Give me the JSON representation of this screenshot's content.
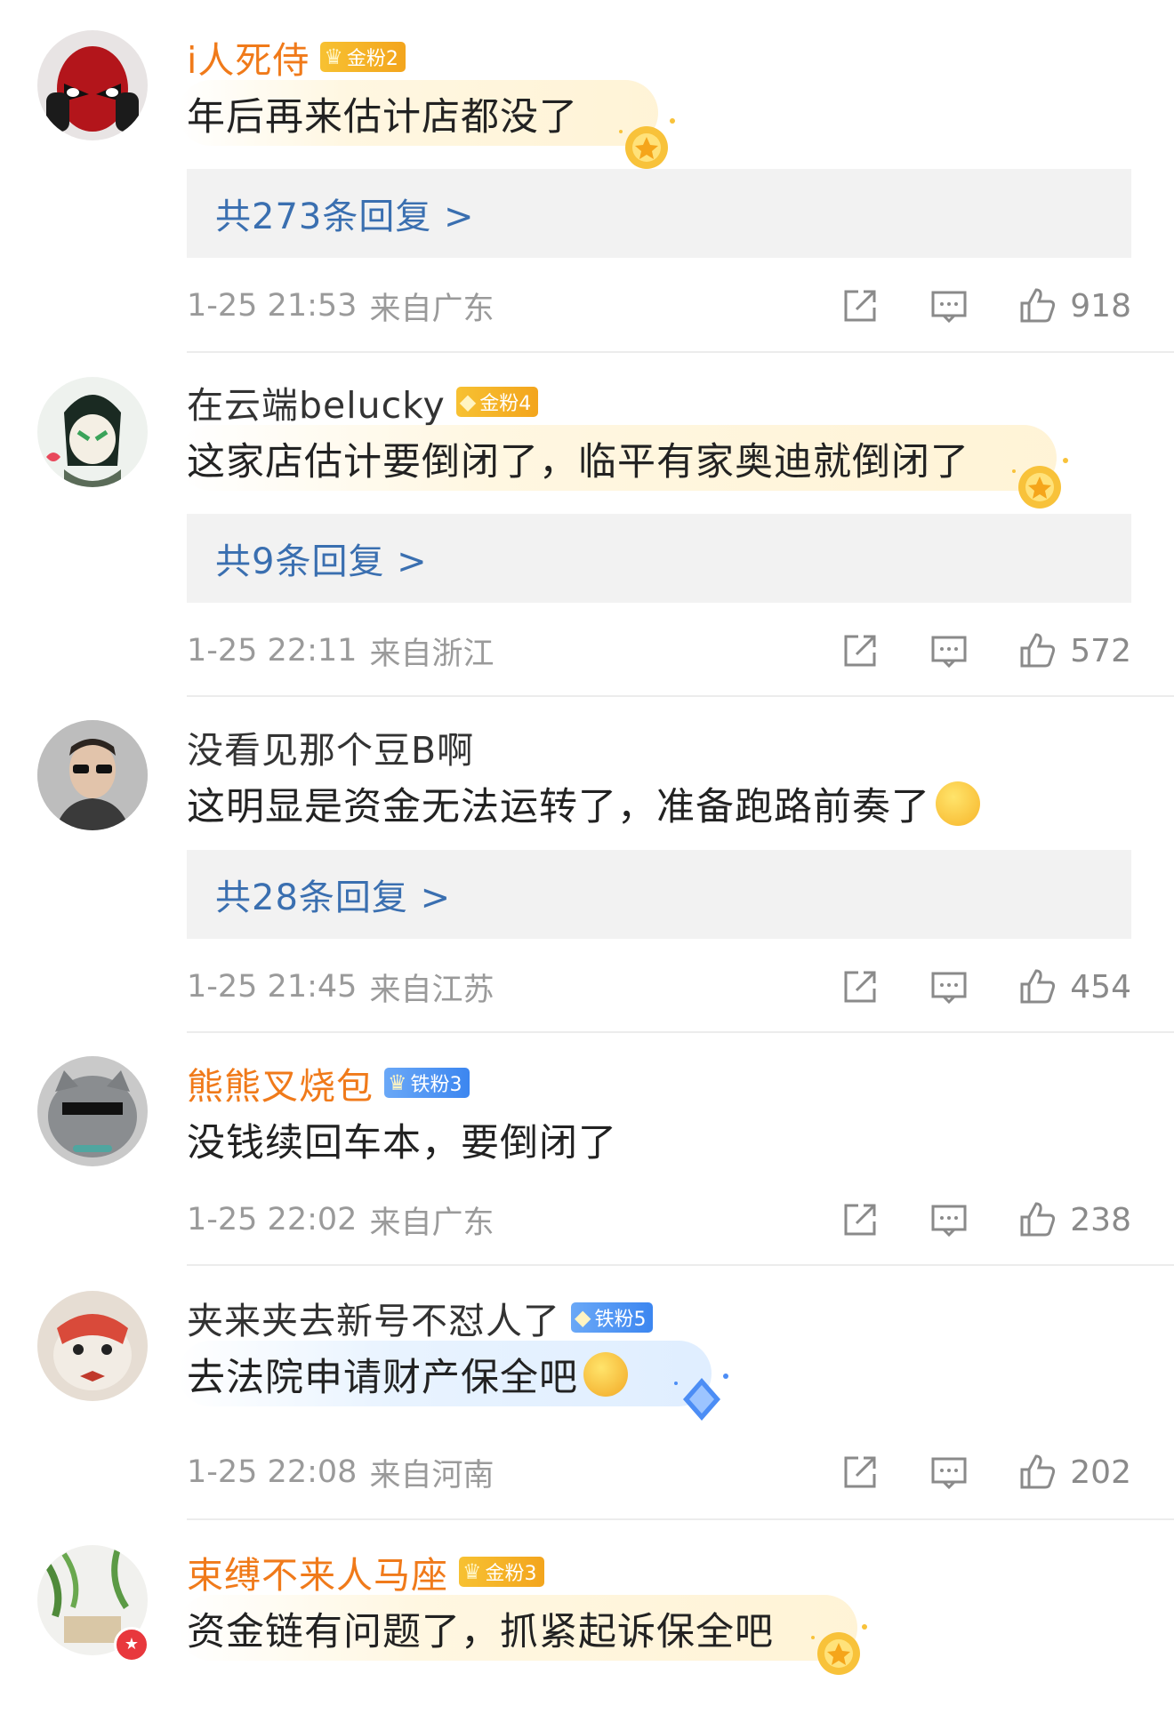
{
  "comments": [
    {
      "username": "i人死侍",
      "username_style": "vip",
      "badge": {
        "type": "gold",
        "label": "金粉2"
      },
      "text": "年后再来估计店都没了",
      "bubble": "gold",
      "emoji": "",
      "replies_label": "共273条回复 >",
      "time": "1-25 21:53",
      "location": "来自广东",
      "likes": "918"
    },
    {
      "username": "在云端belucky",
      "username_style": "normal",
      "badge": {
        "type": "gold",
        "label": "金粉4"
      },
      "text": "这家店估计要倒闭了，临平有家奥迪就倒闭了",
      "bubble": "gold",
      "emoji": "",
      "replies_label": "共9条回复 >",
      "time": "1-25 22:11",
      "location": "来自浙江",
      "likes": "572"
    },
    {
      "username": "没看见那个豆B啊",
      "username_style": "normal",
      "badge": null,
      "text": "这明显是资金无法运转了，准备跑路前奏了",
      "bubble": "",
      "emoji": "drool",
      "replies_label": "共28条回复 >",
      "time": "1-25 21:45",
      "location": "来自江苏",
      "likes": "454"
    },
    {
      "username": "熊熊叉烧包",
      "username_style": "vip",
      "badge": {
        "type": "iron",
        "label": "铁粉3"
      },
      "text": "没钱续回车本，要倒闭了",
      "bubble": "",
      "emoji": "",
      "replies_label": "",
      "time": "1-25 22:02",
      "location": "来自广东",
      "likes": "238"
    },
    {
      "username": "夹来夹去新号不怼人了",
      "username_style": "normal",
      "badge": {
        "type": "iron",
        "label": "铁粉5"
      },
      "text": "去法院申请财产保全吧",
      "bubble": "blue",
      "emoji": "cry",
      "replies_label": "",
      "time": "1-25 22:08",
      "location": "来自河南",
      "likes": "202"
    },
    {
      "username": "束缚不来人马座",
      "username_style": "vip",
      "badge": {
        "type": "gold",
        "label": "金粉3"
      },
      "text": "资金链有问题了，抓紧起诉保全吧",
      "bubble": "gold",
      "emoji": "",
      "replies_label": "",
      "time": "",
      "location": "",
      "likes": ""
    }
  ],
  "icons": {
    "share": "share-icon",
    "reply": "comment-icon",
    "like": "thumbs-up-icon",
    "crown": "crown-icon",
    "diamond": "diamond-icon"
  },
  "colors": {
    "vip_name": "#f07a1a",
    "reply_link": "#3a6fb0",
    "meta": "#9a9a9a"
  }
}
